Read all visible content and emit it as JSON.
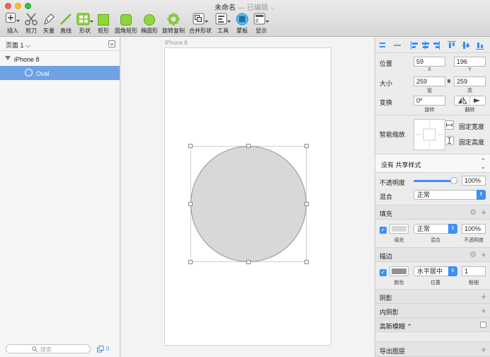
{
  "window": {
    "title": "未命名",
    "subtitle": "— 已编辑 ⌵"
  },
  "toolbar": [
    {
      "label": "插入",
      "icon": "insert-plus-icon"
    },
    {
      "label": "剪刀",
      "icon": "scissors-icon"
    },
    {
      "label": "矢量",
      "icon": "pen-icon"
    },
    {
      "label": "直线",
      "icon": "line-icon"
    },
    {
      "label": "形状",
      "icon": "shapes-icon"
    },
    {
      "label": "矩形",
      "icon": "rectangle-icon"
    },
    {
      "label": "圆角矩形",
      "icon": "rounded-rect-icon"
    },
    {
      "label": "椭圆形",
      "icon": "oval-icon"
    },
    {
      "label": "旋转复制",
      "icon": "rotate-copy-icon"
    },
    {
      "label": "合并形状",
      "icon": "combine-icon"
    },
    {
      "label": "工具",
      "icon": "tools-icon"
    },
    {
      "label": "蒙板",
      "icon": "mask-icon"
    },
    {
      "label": "显示",
      "icon": "view-icon"
    }
  ],
  "colors": {
    "accent": "#3d8ff5",
    "selection": "#6fa1e5",
    "toolbar_green": "#8fd53c",
    "oval_fill": "#d8d8d8",
    "border_color": "#929292"
  },
  "sidebar": {
    "page_selector": "页面 1 ⌵",
    "artboard_name": "iPhone 8",
    "layer_name": "Oval",
    "search_placeholder": "搜索",
    "layer_count": "0"
  },
  "canvas": {
    "artboard_label": "iPhone 8"
  },
  "inspector": {
    "position_label": "位置",
    "x_value": "59",
    "y_value": "196",
    "x_caption": "X",
    "y_caption": "Y",
    "size_label": "大小",
    "width_value": "259",
    "height_value": "259",
    "width_caption": "宽",
    "height_caption": "高",
    "transform_label": "变换",
    "rotation_value": "0º",
    "rotation_caption": "旋转",
    "flip_caption": "翻转",
    "resizing_label": "智能缩放",
    "fix_width_label": "固定宽度",
    "fix_height_label": "固定高度",
    "shared_style": "没有 共享样式",
    "opacity_label": "不透明度",
    "opacity_value": "100%",
    "opacity_fraction": 1.0,
    "blend_label": "混合",
    "blend_value": "正常",
    "fill_title": "填充",
    "fill_blend": "正常",
    "fill_opacity": "100%",
    "fill_caption_fill": "填充",
    "fill_caption_blend": "混合",
    "fill_caption_opacity": "不透明度",
    "border_title": "描边",
    "border_position": "水平居中",
    "border_thickness": "1",
    "border_caption_color": "颜色",
    "border_caption_position": "位置",
    "border_caption_thickness": "粗细",
    "shadow_title": "阴影",
    "inner_shadow_title": "内阴影",
    "blur_title": "高斯模糊 ⌃",
    "export_title": "导出图层"
  }
}
